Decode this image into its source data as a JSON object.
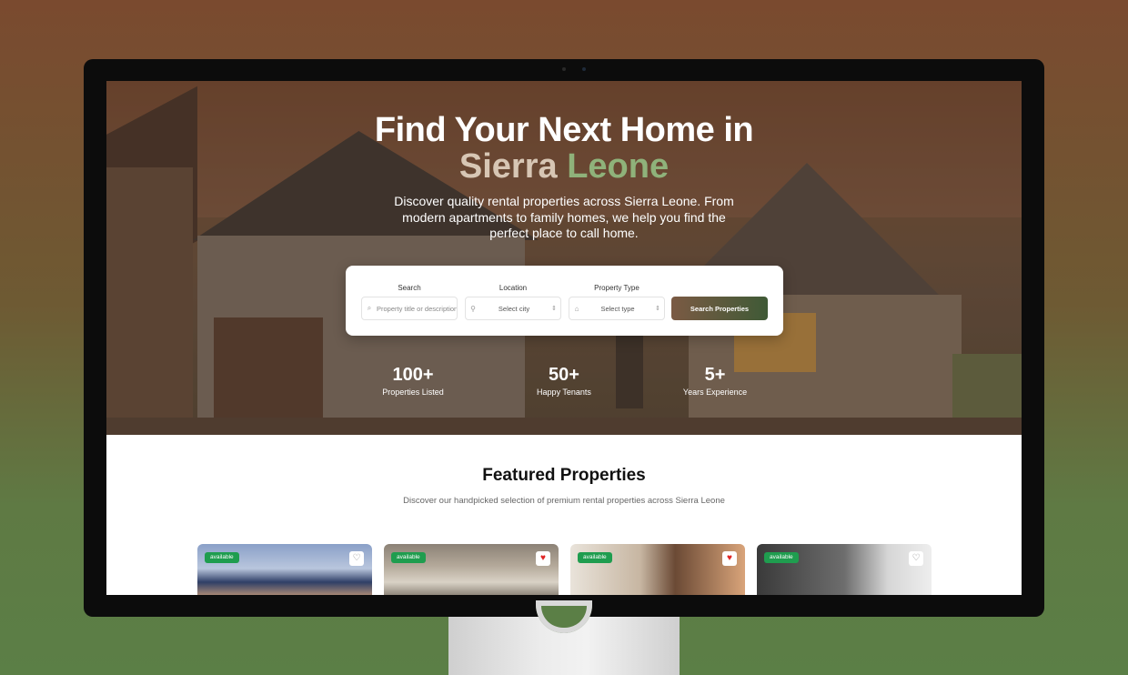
{
  "hero": {
    "title_line1": "Find Your Next Home in",
    "title_word1": "Sierra",
    "title_word2": "Leone",
    "description": "Discover quality rental properties across Sierra Leone. From modern apartments to family homes, we help you find the perfect place to call home."
  },
  "search": {
    "search_label": "Search",
    "search_placeholder": "Property title or description",
    "location_label": "Location",
    "location_value": "Select city",
    "type_label": "Property Type",
    "type_value": "Select type",
    "button_label": "Search Properties"
  },
  "stats": [
    {
      "value": "100+",
      "label": "Properties Listed"
    },
    {
      "value": "50+",
      "label": "Happy Tenants"
    },
    {
      "value": "5+",
      "label": "Years Experience"
    }
  ],
  "featured": {
    "title": "Featured Properties",
    "description": "Discover our handpicked selection of premium rental properties across Sierra Leone"
  },
  "cards": [
    {
      "badge": "available",
      "favorited": false
    },
    {
      "badge": "available",
      "favorited": true
    },
    {
      "badge": "available",
      "favorited": true
    },
    {
      "badge": "available",
      "favorited": false
    }
  ],
  "icons": {
    "search": "search-icon",
    "location": "map-pin-icon",
    "type": "home-icon",
    "favorite": "heart-icon"
  },
  "colors": {
    "accent_green": "#8fb27a",
    "badge_green": "#1f9d4f",
    "heart_red": "#e02424"
  }
}
